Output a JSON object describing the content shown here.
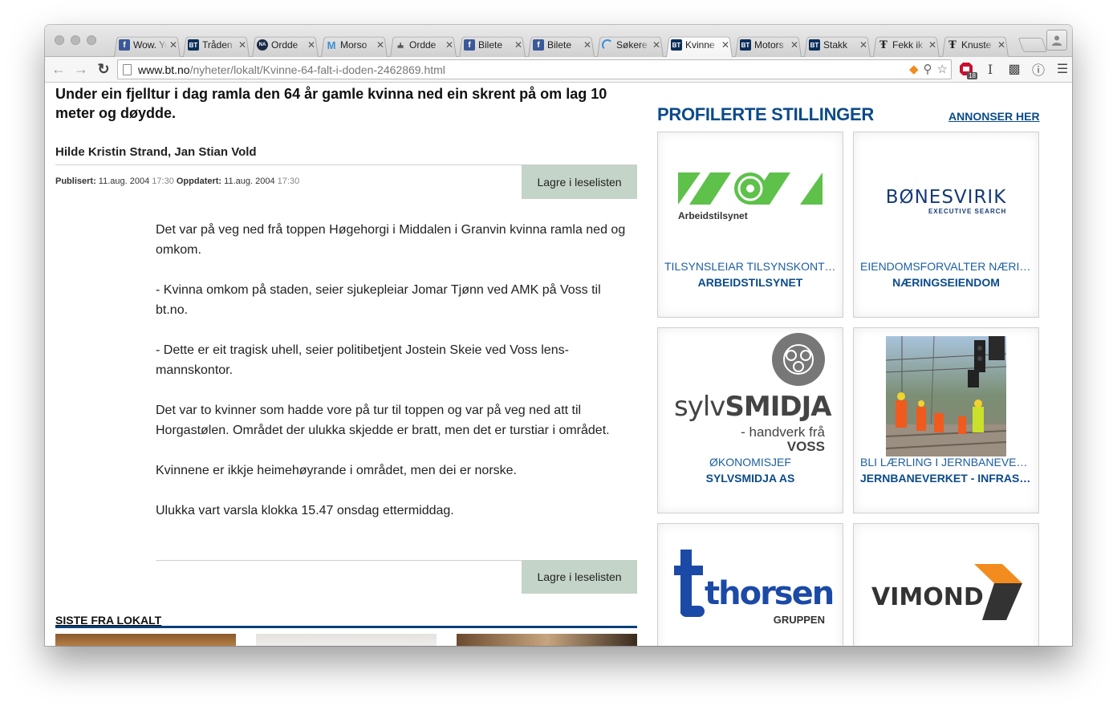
{
  "browser": {
    "tabs": [
      {
        "title": "Wow. Yo",
        "icon": "facebook-icon",
        "active": false
      },
      {
        "title": "Tråden",
        "icon": "bt-icon",
        "active": false
      },
      {
        "title": "Ordde",
        "icon": "na-icon",
        "active": false
      },
      {
        "title": "Morso",
        "icon": "m-icon",
        "active": false
      },
      {
        "title": "Ordde",
        "icon": "telenor-icon",
        "active": false
      },
      {
        "title": "Bilete",
        "icon": "facebook-icon",
        "active": false
      },
      {
        "title": "Bilete",
        "icon": "facebook-icon",
        "active": false
      },
      {
        "title": "Søkere",
        "icon": "loading-icon",
        "active": false
      },
      {
        "title": "Kvinne",
        "icon": "bt-icon",
        "active": true
      },
      {
        "title": "Motors",
        "icon": "bt-icon",
        "active": false
      },
      {
        "title": "Stakk",
        "icon": "bt-icon",
        "active": false
      },
      {
        "title": "Fekk ik",
        "icon": "fj-icon",
        "active": false
      },
      {
        "title": "Knuste",
        "icon": "fj-icon",
        "active": false
      }
    ],
    "url_domain": "www.bt.no",
    "url_path": "/nyheter/lokalt/Kvinne-64-falt-i-doden-2462869.html",
    "ext_badge": "18"
  },
  "article": {
    "lead": "Under ein fjelltur i dag ramla den 64 år gamle kvinna ned ein skrent på om lag 10 meter og døydde.",
    "authors": "Hilde Kristin Strand, Jan Stian Vold",
    "published_label": "Publisert:",
    "published_date": "11.aug. 2004",
    "published_time": "17:30",
    "updated_label": "Oppdatert:",
    "updated_date": "11.aug. 2004",
    "updated_time": "17:30",
    "save_label": "Lagre i leselisten",
    "paragraphs": [
      "Det var på veg ned frå toppen Høgehorgi i Middalen i Granvin kvinna ramla ned og omkom.",
      "- Kvinna omkom på staden, seier sjukepleiar Jomar Tjønn ved AMK på Voss til bt.no.",
      "- Dette er eit tragisk uhell, seier politibetjent Jostein Skeie ved Voss lens-mannskontor.",
      "Det var to kvinner som hadde vore på tur til toppen og var på veg ned att til Horgastølen. Området der ulukka skjedde er bratt, men det er turstiar i området.",
      "Kvinnene er ikkje heimehøyrande i området, men dei er norske.",
      "Ulukka vart varsla klokka 15.47 onsdag ettermiddag."
    ],
    "section_title": "SISTE FRA LOKALT"
  },
  "sidebar": {
    "title": "PROFILERTE STILLINGER",
    "advertise_link": "ANNONSER HER",
    "jobs": [
      {
        "role": "TILSYNSLEIAR TILSYNSKONTOR",
        "company": "ARBEIDSTILSYNET",
        "logo_text": "Arbeidstilsynet"
      },
      {
        "role": "EIENDOMSFORVALTER NÆRINGSEIENDOM",
        "company": "NÆRINGSEIENDOM",
        "logo_text": "BØNESVIRIK",
        "logo_sub": "EXECUTIVE SEARCH"
      },
      {
        "role": "ØKONOMISJEF",
        "company": "SYLVSMIDJA AS",
        "logo_text_a": "sylv",
        "logo_text_b": "SMIDJA",
        "logo_sub": "- handverk frå",
        "logo_sub2": "VOSS"
      },
      {
        "role": "BLI LÆRLING I JERNBANEVERKET",
        "company": "JERNBANEVERKET - INFRASTRUKTUR"
      },
      {
        "logo_text": "thorsen",
        "logo_sub": "GRUPPEN"
      },
      {
        "logo_text": "VIMOND"
      }
    ]
  },
  "colors": {
    "accent": "#0b4b8a",
    "save_button": "#c4d4c8",
    "arbeid_green": "#5ec14a",
    "vimond_orange": "#f28c1e"
  }
}
